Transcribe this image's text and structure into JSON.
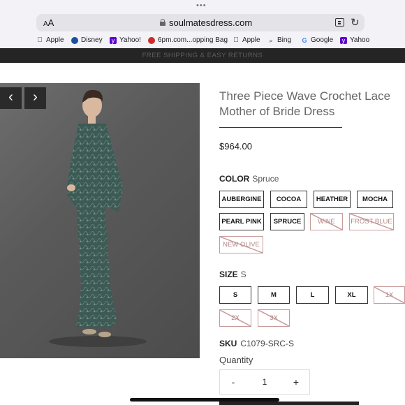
{
  "browser": {
    "text_size_label": "AA",
    "url": "soulmatesdress.com",
    "bookmarks": [
      {
        "label": "Apple",
        "icon": "apple-icon"
      },
      {
        "label": "Disney",
        "icon": "disney-icon"
      },
      {
        "label": "Yahoo!",
        "icon": "yahoo-icon"
      },
      {
        "label": "6pm.com...opping Bag",
        "icon": "6pm-icon"
      },
      {
        "label": "Apple",
        "icon": "apple-icon"
      },
      {
        "label": "Bing",
        "icon": "search-icon"
      },
      {
        "label": "Google",
        "icon": "google-icon"
      },
      {
        "label": "Yahoo",
        "icon": "yahoo-icon"
      }
    ]
  },
  "banner": {
    "text": "FREE SHIPPING & EASY RETURNS"
  },
  "gallery": {
    "prev_icon": "chevron-left-icon",
    "next_icon": "chevron-right-icon"
  },
  "product": {
    "title_line1": "Three Piece Wave Crochet Lace",
    "title_line2": "Mother of Bride Dress",
    "price": "$964.00",
    "color": {
      "label": "COLOR",
      "selected": "Spruce",
      "options": [
        {
          "name": "AUBERGINE",
          "available": true
        },
        {
          "name": "COCOA",
          "available": true
        },
        {
          "name": "HEATHER",
          "available": true
        },
        {
          "name": "MOCHA",
          "available": true
        },
        {
          "name": "PEARL PINK",
          "available": true
        },
        {
          "name": "SPRUCE",
          "available": true
        },
        {
          "name": "WINE",
          "available": false
        },
        {
          "name": "FROST BLUE",
          "available": false
        },
        {
          "name": "NEW OLIVE",
          "available": false
        }
      ]
    },
    "size": {
      "label": "SIZE",
      "selected": "S",
      "options": [
        {
          "name": "S",
          "available": true
        },
        {
          "name": "M",
          "available": true
        },
        {
          "name": "L",
          "available": true
        },
        {
          "name": "XL",
          "available": true
        },
        {
          "name": "1X",
          "available": false
        },
        {
          "name": "2X",
          "available": false
        },
        {
          "name": "3X",
          "available": false
        }
      ]
    },
    "sku": {
      "label": "SKU",
      "value": "C1079-SRC-S"
    },
    "quantity": {
      "label": "Quantity",
      "value": "1",
      "minus": "-",
      "plus": "+"
    }
  },
  "colors": {
    "dress": "#3d5a55",
    "unavailable_border": "#c89a9a",
    "banner_bg": "#252525"
  }
}
